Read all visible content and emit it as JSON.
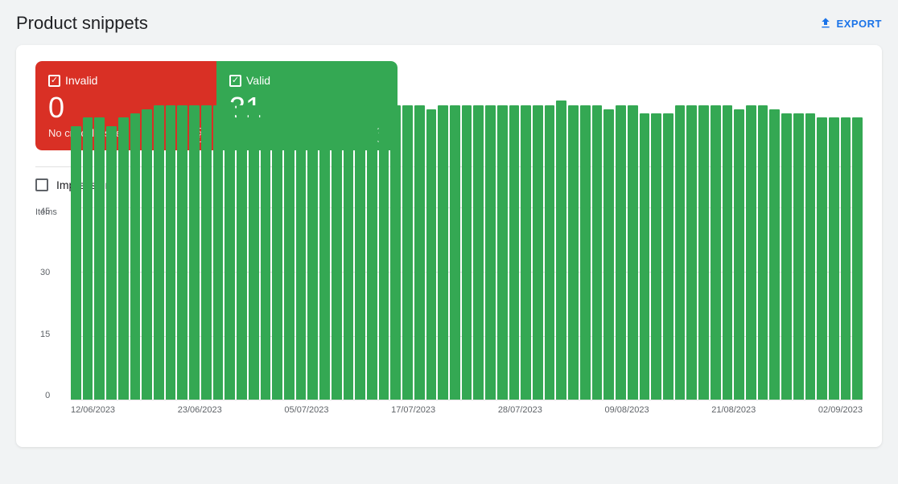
{
  "header": {
    "title": "Product snippets",
    "export_label": "EXPORT"
  },
  "metrics": {
    "invalid": {
      "label": "Invalid",
      "value": "0",
      "sub": "No critical issues"
    },
    "valid": {
      "label": "Valid",
      "value": "31"
    }
  },
  "impressions": {
    "label": "Impressions"
  },
  "chart": {
    "y_axis_label": "Items",
    "y_labels": [
      "45",
      "30",
      "15",
      "0"
    ],
    "x_labels": [
      "12/06/2023",
      "23/06/2023",
      "05/07/2023",
      "17/07/2023",
      "28/07/2023",
      "09/08/2023",
      "21/08/2023",
      "02/09/2023"
    ],
    "bars": [
      64,
      66,
      66,
      64,
      66,
      67,
      68,
      69,
      69,
      69,
      69,
      69,
      69,
      69,
      69,
      69,
      69,
      69,
      69,
      69,
      69,
      68,
      69,
      69,
      69,
      69,
      68,
      69,
      69,
      69,
      68,
      69,
      69,
      69,
      69,
      69,
      69,
      69,
      69,
      69,
      69,
      70,
      69,
      69,
      69,
      68,
      69,
      69,
      67,
      67,
      67,
      69,
      69,
      69,
      69,
      69,
      68,
      69,
      69,
      68,
      67,
      67,
      67,
      66,
      66,
      66,
      66
    ]
  }
}
